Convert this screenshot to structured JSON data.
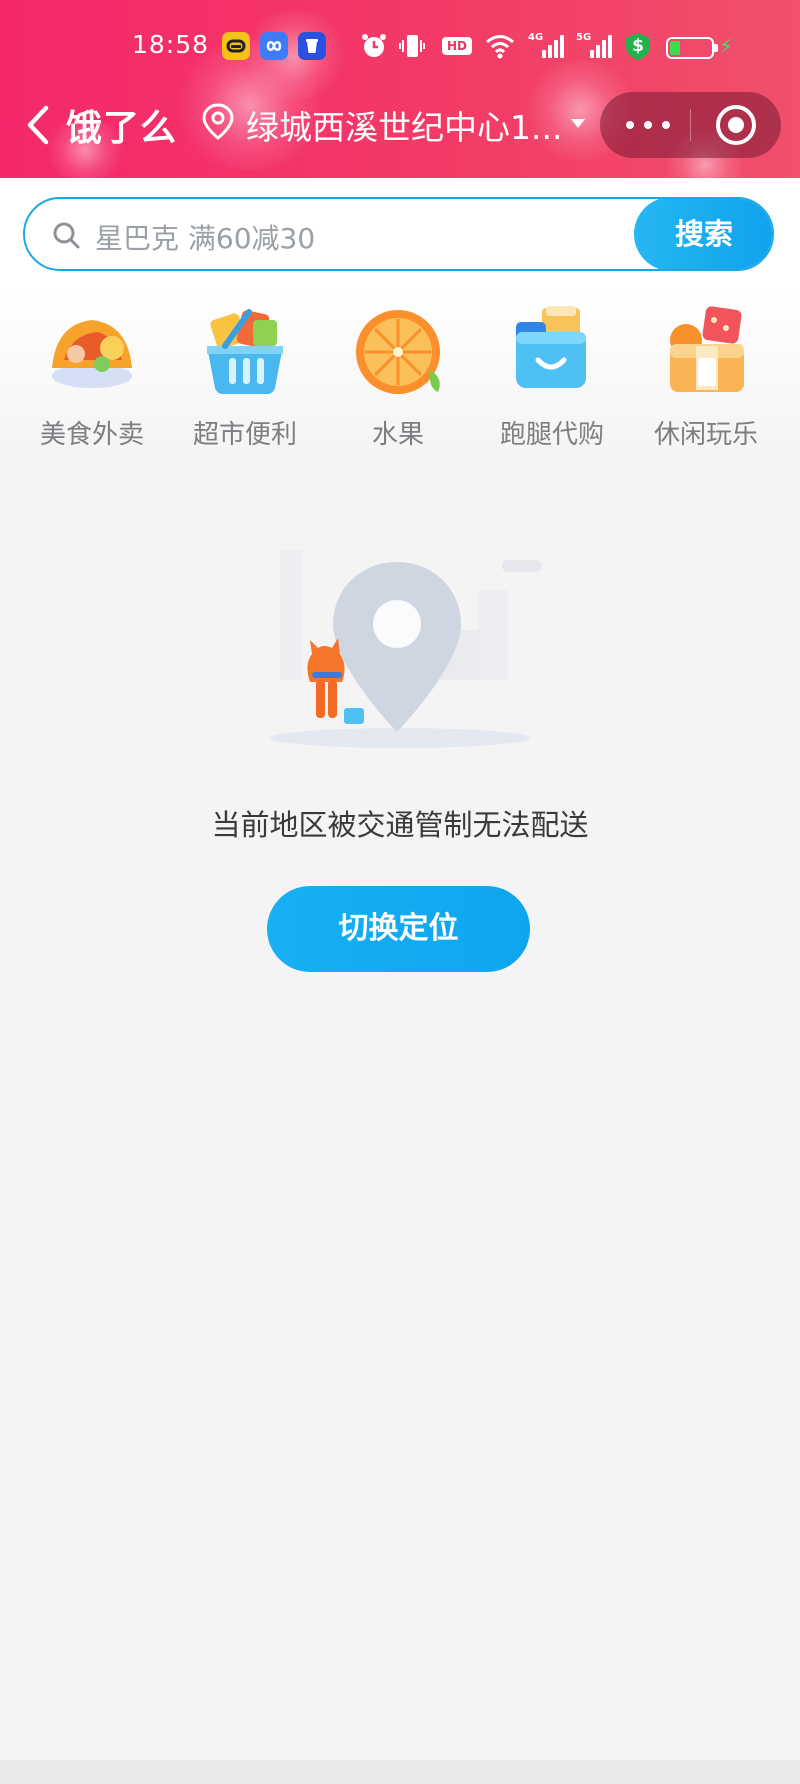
{
  "status_bar": {
    "time": "18:58",
    "app_icons": [
      "a-app-icon",
      "infinity-app-icon",
      "cup-app-icon"
    ],
    "system_icons": [
      "alarm-icon",
      "vibrate-icon",
      "hd-icon",
      "wifi-icon",
      "signal-4g-icon",
      "signal-5g-icon",
      "shield-dollar-icon",
      "battery-icon",
      "charging-icon"
    ],
    "hd_label": "HD",
    "sim1_label": "4G",
    "sim2_label": "5G",
    "shield_label": "$",
    "battery_level": 0.25,
    "battery_color": "#3ddc4f"
  },
  "header": {
    "brand": "饿了么",
    "address": "绿城西溪世纪中心1...",
    "gradient_colors": [
      "#f4286a",
      "#f0506c"
    ]
  },
  "search": {
    "placeholder": "星巴克  满60减30",
    "button_label": "搜索",
    "accent_color": "#1aa7e6"
  },
  "categories": [
    {
      "label": "美食外卖",
      "icon": "food-delivery-icon"
    },
    {
      "label": "超市便利",
      "icon": "supermarket-basket-icon"
    },
    {
      "label": "水果",
      "icon": "fruit-orange-icon"
    },
    {
      "label": "跑腿代购",
      "icon": "errand-bag-icon"
    },
    {
      "label": "休闲玩乐",
      "icon": "leisure-gift-icon"
    }
  ],
  "empty_state": {
    "illustration": "location-pin-fox-illustration",
    "message": "当前地区被交通管制无法配送",
    "button_label": "切换定位",
    "button_color": "#18b0f2"
  }
}
